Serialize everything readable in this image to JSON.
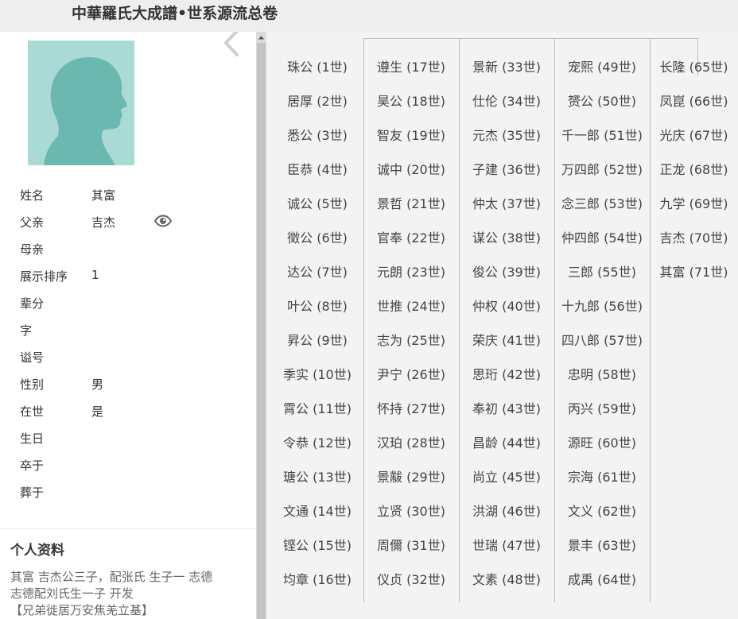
{
  "header": {
    "title": "中華羅氏大成譜•世系源流总卷"
  },
  "profile": {
    "fields": [
      {
        "label": "姓名",
        "value": "其富"
      },
      {
        "label": "父亲",
        "value": "吉杰"
      },
      {
        "label": "母亲",
        "value": ""
      },
      {
        "label": "展示排序",
        "value": "1"
      },
      {
        "label": "辈分",
        "value": ""
      },
      {
        "label": "字",
        "value": ""
      },
      {
        "label": "谥号",
        "value": ""
      },
      {
        "label": "性别",
        "value": "男"
      },
      {
        "label": "在世",
        "value": "是"
      },
      {
        "label": "生日",
        "value": ""
      },
      {
        "label": "卒于",
        "value": ""
      },
      {
        "label": "葬于",
        "value": ""
      }
    ],
    "icons": {
      "avatar": "person-silhouette-icon",
      "view": "eye-icon",
      "collapse": "chevron-left-icon"
    },
    "avatar_colors": {
      "background": "#a9dad6",
      "figure": "#6bb8b0"
    }
  },
  "bio": {
    "title": "个人资料",
    "lines": [
      "其富  吉杰公三子，配张氏  生子一  志德",
      "志德配刘氏生一子  开发",
      "【兄弟徙居万安焦羌立基】"
    ]
  },
  "generations": [
    [
      "珠公 (1世)",
      "居厚 (2世)",
      "悉公 (3世)",
      "臣恭 (4世)",
      "诚公 (5世)",
      "徵公 (6世)",
      "达公 (7世)",
      "叶公 (8世)",
      "昇公 (9世)",
      "季实 (10世)",
      "霄公 (11世)",
      "令恭 (12世)",
      "瑭公 (13世)",
      "文通 (14世)",
      "铿公 (15世)",
      "均章 (16世)"
    ],
    [
      "遵生 (17世)",
      "昊公 (18世)",
      "智友 (19世)",
      "诚中 (20世)",
      "景哲 (21世)",
      "官奉 (22世)",
      "元朗 (23世)",
      "世推 (24世)",
      "志为 (25世)",
      "尹宁 (26世)",
      "怀持 (27世)",
      "汉珀 (28世)",
      "景黻 (29世)",
      "立贤 (30世)",
      "周儞 (31世)",
      "仪贞 (32世)"
    ],
    [
      "景新 (33世)",
      "仕伦 (34世)",
      "元杰 (35世)",
      "子建 (36世)",
      "仲太 (37世)",
      "谋公 (38世)",
      "俊公 (39世)",
      "仲权 (40世)",
      "荣庆 (41世)",
      "思珩 (42世)",
      "奉初 (43世)",
      "昌龄 (44世)",
      "尚立 (45世)",
      "洪湖 (46世)",
      "世瑞 (47世)",
      "文素 (48世)"
    ],
    [
      "宠熙 (49世)",
      "赟公 (50世)",
      "千一郎 (51世)",
      "万四郎 (52世)",
      "念三郎 (53世)",
      "仲四郎 (54世)",
      "三郎 (55世)",
      "十九郎 (56世)",
      "四八郎 (57世)",
      "忠明 (58世)",
      "丙兴 (59世)",
      "源旺 (60世)",
      "宗海 (61世)",
      "文义 (62世)",
      "景丰 (63世)",
      "成禹 (64世)"
    ],
    [
      "长隆 (65世)",
      "凤崑 (66世)",
      "光庆 (67世)",
      "正龙 (68世)",
      "九学 (69世)",
      "吉杰 (70世)",
      "其富 (71世)"
    ]
  ]
}
